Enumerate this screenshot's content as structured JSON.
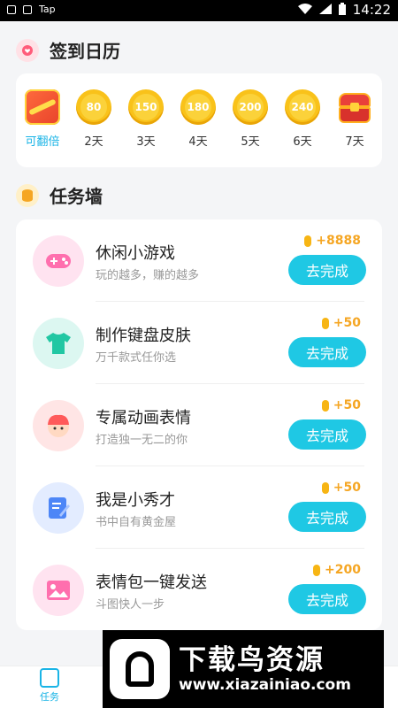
{
  "status_bar": {
    "left_app": "Tap",
    "time": "14:22"
  },
  "signin": {
    "title": "签到日历"
  },
  "days": [
    {
      "label": "可翻倍",
      "value": "",
      "kind": "redbox"
    },
    {
      "label": "2天",
      "value": "80",
      "kind": "coin"
    },
    {
      "label": "3天",
      "value": "150",
      "kind": "coin"
    },
    {
      "label": "4天",
      "value": "180",
      "kind": "coin"
    },
    {
      "label": "5天",
      "value": "200",
      "kind": "coin"
    },
    {
      "label": "6天",
      "value": "240",
      "kind": "coin"
    },
    {
      "label": "7天",
      "value": "",
      "kind": "chest"
    }
  ],
  "tasks_section": {
    "title": "任务墙"
  },
  "tasks": [
    {
      "title": "休闲小游戏",
      "subtitle": "玩的越多，赚的越多",
      "reward": "+8888",
      "button": "去完成",
      "icon": "gamepad-icon"
    },
    {
      "title": "制作键盘皮肤",
      "subtitle": "万千款式任你选",
      "reward": "+50",
      "button": "去完成",
      "icon": "tshirt-icon"
    },
    {
      "title": "专属动画表情",
      "subtitle": "打造独一无二的你",
      "reward": "+50",
      "button": "去完成",
      "icon": "avatar-icon"
    },
    {
      "title": "我是小秀才",
      "subtitle": "书中自有黄金屋",
      "reward": "+50",
      "button": "去完成",
      "icon": "edit-icon"
    },
    {
      "title": "表情包一键发送",
      "subtitle": "斗图快人一步",
      "reward": "+200",
      "button": "去完成",
      "icon": "image-icon"
    }
  ],
  "tabbar": {
    "tab_tasks": "任务"
  },
  "watermark": {
    "title": "下载鸟资源",
    "url": "www.xiazainiao.com"
  },
  "colors": {
    "accent": "#1fc8e4",
    "coin": "#f9c21a",
    "reward": "#f5a623"
  }
}
